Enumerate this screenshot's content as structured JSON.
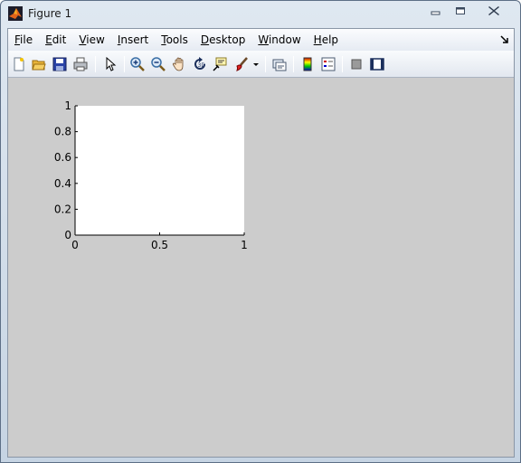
{
  "window": {
    "title": "Figure 1"
  },
  "menubar": {
    "items": [
      {
        "key": "F",
        "rest": "ile"
      },
      {
        "key": "E",
        "rest": "dit"
      },
      {
        "key": "V",
        "rest": "iew"
      },
      {
        "key": "I",
        "rest": "nsert"
      },
      {
        "key": "T",
        "rest": "ools"
      },
      {
        "key": "D",
        "rest": "esktop"
      },
      {
        "key": "W",
        "rest": "indow"
      },
      {
        "key": "H",
        "rest": "elp"
      }
    ]
  },
  "toolbar": {
    "buttons": [
      "new-figure-icon",
      "open-file-icon",
      "save-icon",
      "print-icon",
      "edit-plot-arrow-icon",
      "zoom-in-icon",
      "zoom-out-icon",
      "pan-hand-icon",
      "rotate-3d-icon",
      "data-cursor-icon",
      "brush-icon",
      "brush-dropdown-icon",
      "link-plot-icon",
      "colorbar-icon",
      "legend-icon",
      "hide-plot-tools-icon",
      "show-plot-tools-icon"
    ]
  },
  "chart_data": {
    "type": "line",
    "x": [],
    "series": [],
    "xlim": [
      0,
      1
    ],
    "ylim": [
      0,
      1
    ],
    "x_ticks": [
      "0",
      "0.5",
      "1"
    ],
    "y_ticks": [
      "0",
      "0.2",
      "0.4",
      "0.6",
      "0.8",
      "1"
    ],
    "grid": false,
    "title": "",
    "xlabel": "",
    "ylabel": ""
  }
}
